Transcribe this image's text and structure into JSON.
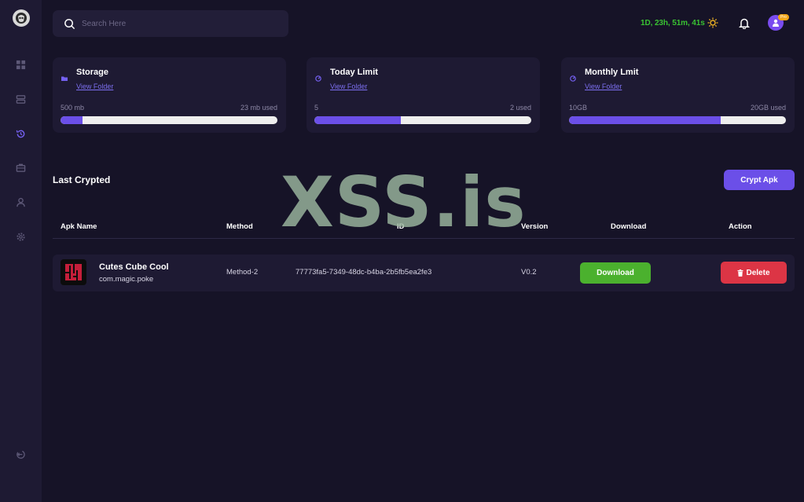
{
  "search": {
    "placeholder": "Search Here"
  },
  "header": {
    "timer": "1D, 23h, 51m, 41s",
    "pro_badge": "Pro"
  },
  "sidebar": {
    "items": [
      {
        "icon": "dashboard-icon"
      },
      {
        "icon": "storage-icon"
      },
      {
        "icon": "history-icon",
        "active": true
      },
      {
        "icon": "briefcase-icon"
      },
      {
        "icon": "user-icon"
      },
      {
        "icon": "settings-icon"
      },
      {
        "icon": "logout-icon"
      }
    ]
  },
  "cards": [
    {
      "title": "Storage",
      "link": "View Folder",
      "left_label": "500 mb",
      "right_label": "23 mb used",
      "progress": 0.1
    },
    {
      "title": "Today Limit",
      "link": "View Folder",
      "left_label": "5",
      "right_label": "2 used",
      "progress": 0.4
    },
    {
      "title": "Monthly Lmit",
      "link": "View Folder",
      "left_label": "10GB",
      "right_label": "20GB used",
      "progress": 0.7
    }
  ],
  "section": {
    "title": "Last Crypted",
    "crypt_button": "Crypt Apk"
  },
  "table": {
    "headers": [
      "Apk Name",
      "Method",
      "ID",
      "Version",
      "Download",
      "Action"
    ],
    "rows": [
      {
        "name": "Cutes Cube Cool",
        "package": "com.magic.poke",
        "method": "Method-2",
        "id": "77773fa5-7349-48dc-b4ba-2b5fb5ea2fe3",
        "version": "V0.2",
        "download_label": "Download",
        "delete_label": "Delete"
      }
    ]
  },
  "watermark": "XSS.is",
  "colors": {
    "background": "#161327",
    "panel": "#1e1a33",
    "accent": "#6b4fe8",
    "success": "#4bb12e",
    "danger": "#dc3545",
    "timer": "#39c232"
  }
}
